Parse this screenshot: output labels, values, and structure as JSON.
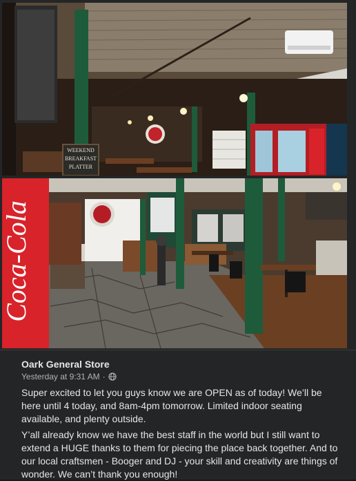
{
  "post": {
    "page_name": "Oark General Store",
    "timestamp": "Yesterday at 9:31 AM",
    "separator": "·",
    "audience_icon": "globe-icon",
    "paragraphs": [
      "Super excited to let you guys know we are OPEN as of today!  We’ll be here until 4 today, and 8am-4pm tomorrow. Limited indoor seating available, and plenty outside.",
      "Y’all already know we have the best staff in the world but I still want to extend a HUGE thanks to them for piecing the place back together. And to our local craftsmen - Booger and DJ - your skill and creativity are things of wonder. We can’t thank you enough!"
    ]
  },
  "photos": {
    "top_signs": {
      "chalkboard": "WEEKEND BREAKFAST PLATTER"
    },
    "bottom_signs": {
      "cooler": "Coca-Cola"
    }
  },
  "colors": {
    "background": "#242526",
    "text_primary": "#e4e6eb",
    "text_secondary": "#b0b3b8",
    "coca_cola_red": "#d8232a",
    "beam_green": "#1e5b3a"
  }
}
